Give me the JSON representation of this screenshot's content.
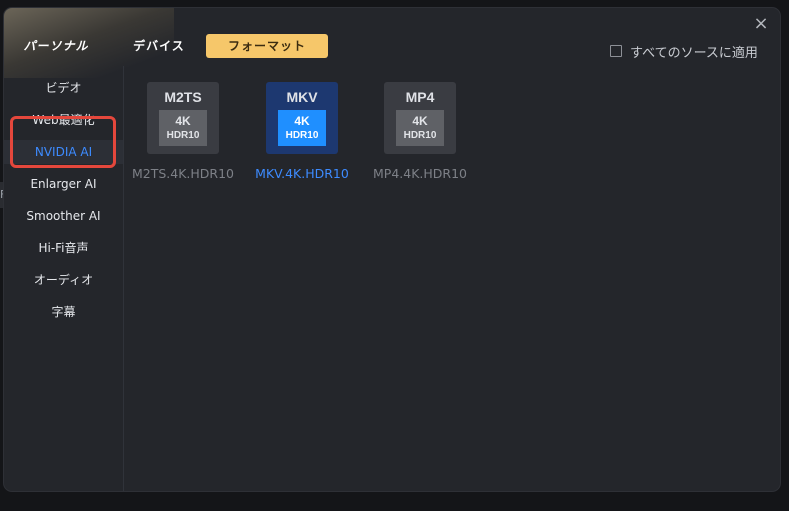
{
  "tabs": {
    "personal": "パーソナル",
    "device": "デバイス",
    "format": "フォーマット"
  },
  "apply_all_label": "すべてのソースに適用",
  "close_glyph": "×",
  "background_text": "F",
  "sidebar": {
    "items": [
      {
        "label": "ビデオ"
      },
      {
        "label": "Web最適化"
      },
      {
        "label": "NVIDIA AI",
        "active": true
      },
      {
        "label": "Enlarger AI"
      },
      {
        "label": "Smoother AI"
      },
      {
        "label": "Hi-Fi音声"
      },
      {
        "label": "オーディオ"
      },
      {
        "label": "字幕"
      }
    ]
  },
  "formats": [
    {
      "title": "M2TS",
      "res": "4K",
      "hdr": "HDR10",
      "label": "M2TS.4K.HDR10",
      "selected": false
    },
    {
      "title": "MKV",
      "res": "4K",
      "hdr": "HDR10",
      "label": "MKV.4K.HDR10",
      "selected": true
    },
    {
      "title": "MP4",
      "res": "4K",
      "hdr": "HDR10",
      "label": "MP4.4K.HDR10",
      "selected": false
    }
  ],
  "colors": {
    "accent": "#3d8bff",
    "tab_active": "#f6c76a",
    "highlight_box": "#e4473c",
    "dialog_bg": "#24262b"
  }
}
